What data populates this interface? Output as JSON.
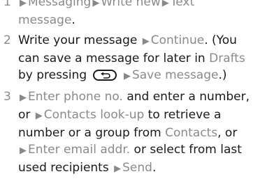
{
  "steps": [
    {
      "num": "1",
      "lines": [
        [
          {
            "t": "tri"
          },
          {
            "t": "hl",
            "v": "Messaging"
          },
          {
            "t": "tri"
          },
          {
            "t": "hl",
            "v": "Write new"
          },
          {
            "t": "tri"
          },
          {
            "t": "hl",
            "v": "Text"
          }
        ],
        [
          {
            "t": "hl",
            "v": "message"
          },
          {
            "t": "plain",
            "v": "."
          }
        ]
      ]
    },
    {
      "num": "2",
      "lines": [
        [
          {
            "t": "plain",
            "v": "Write your message "
          },
          {
            "t": "tri"
          },
          {
            "t": "hl",
            "v": "Continue"
          },
          {
            "t": "plain",
            "v": ". (You"
          }
        ],
        [
          {
            "t": "plain",
            "v": "can save a message for later in "
          },
          {
            "t": "hl",
            "v": "Drafts"
          }
        ],
        [
          {
            "t": "plain",
            "v": "by pressing "
          },
          {
            "t": "key",
            "v": "back-key-icon"
          },
          {
            "t": "plain",
            "v": " "
          },
          {
            "t": "tri"
          },
          {
            "t": "hl",
            "v": "Save message"
          },
          {
            "t": "plain",
            "v": ".)"
          }
        ]
      ]
    },
    {
      "num": "3",
      "lines": [
        [
          {
            "t": "tri"
          },
          {
            "t": "hl",
            "v": "Enter phone no."
          },
          {
            "t": "plain",
            "v": " and enter a number,"
          }
        ],
        [
          {
            "t": "plain",
            "v": "or "
          },
          {
            "t": "tri"
          },
          {
            "t": "hl",
            "v": "Contacts look-up"
          },
          {
            "t": "plain",
            "v": " to retrieve a"
          }
        ],
        [
          {
            "t": "plain",
            "v": "number or a group from "
          },
          {
            "t": "hl",
            "v": "Contacts"
          },
          {
            "t": "plain",
            "v": ", or"
          }
        ],
        [
          {
            "t": "tri"
          },
          {
            "t": "hl",
            "v": "Enter email addr."
          },
          {
            "t": "plain",
            "v": " or select from last"
          }
        ],
        [
          {
            "t": "plain",
            "v": "used recipients "
          },
          {
            "t": "tri"
          },
          {
            "t": "hl",
            "v": "Send"
          },
          {
            "t": "plain",
            "v": "."
          }
        ]
      ]
    }
  ]
}
